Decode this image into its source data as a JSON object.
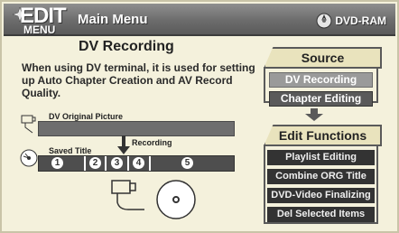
{
  "header": {
    "logo_edit": "EDIT",
    "logo_menu": "MENU",
    "title": "Main Menu",
    "media": "DVD-RAM",
    "icons": [
      "disc-icon",
      "dvd-ram-icon"
    ]
  },
  "info": {
    "title": "DV Recording",
    "description": "When using DV terminal, it is used for setting up Auto Chapter Creation and AV Record Quality."
  },
  "diagram": {
    "dv_original_label": "DV Original Picture",
    "recording_label": "Recording",
    "saved_title_label": "Saved Title",
    "title_numbers": [
      "1",
      "2",
      "3",
      "4",
      "5"
    ],
    "icons": [
      "camcorder-icon",
      "disc-icon",
      "down-arrow-icon"
    ]
  },
  "source": {
    "heading": "Source",
    "items": [
      {
        "label": "DV Recording",
        "selected": true
      },
      {
        "label": "Chapter Editing",
        "selected": false
      }
    ]
  },
  "edit_functions": {
    "heading": "Edit Functions",
    "items": [
      {
        "label": "Playlist Editing"
      },
      {
        "label": "Combine ORG Title"
      },
      {
        "label": "DVD-Video Finalizing"
      },
      {
        "label": "Del Selected Items"
      }
    ]
  },
  "colors": {
    "background": "#f4f1dc",
    "header": "#6c6c6c",
    "selected_item": "#9a9a9a",
    "button": "#333333"
  }
}
